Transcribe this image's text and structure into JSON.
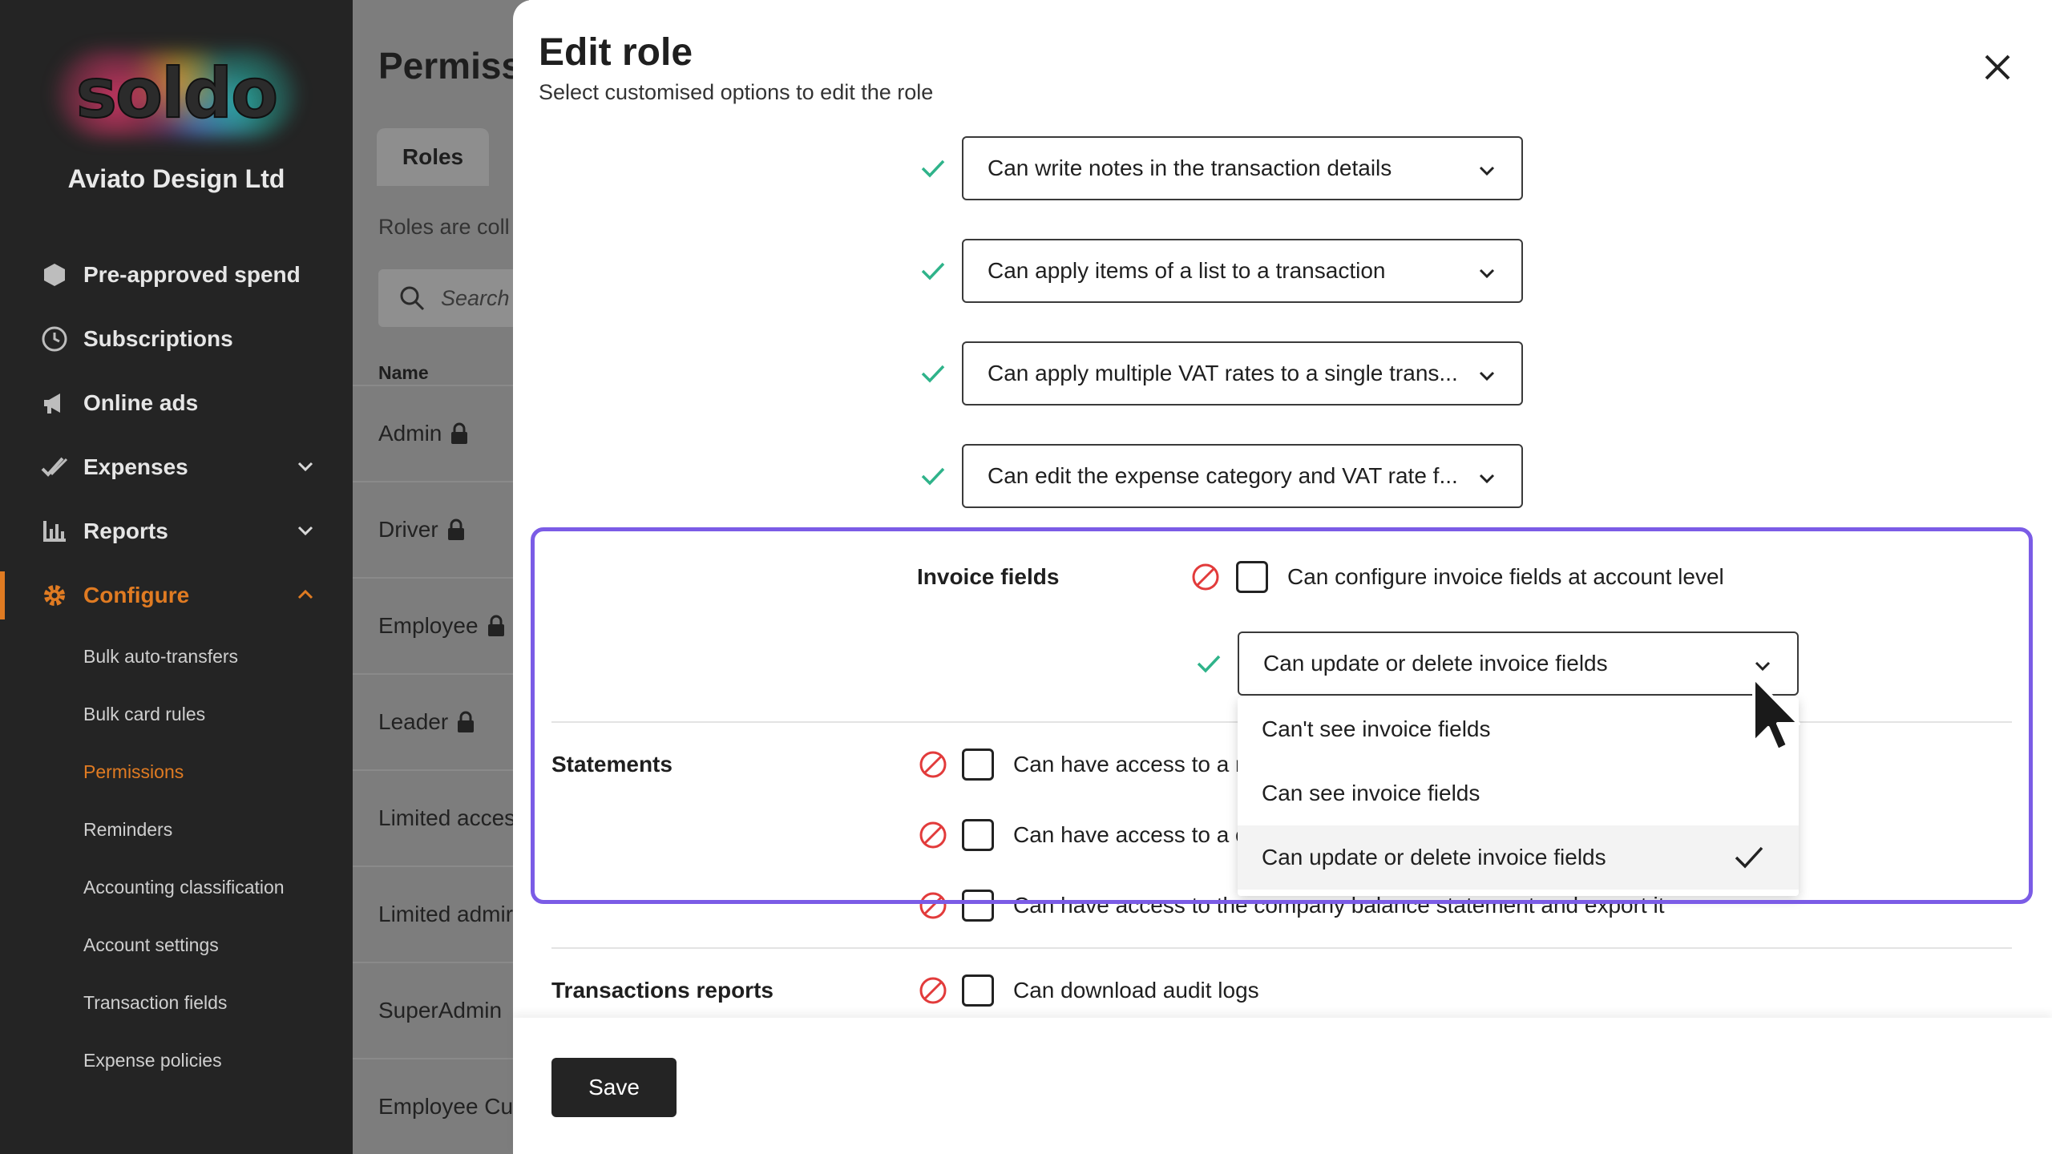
{
  "sidebar": {
    "logo_text": "soldo",
    "company": "Aviato Design Ltd",
    "nav": [
      {
        "label": "Pre-approved spend",
        "icon": "hexagon-icon"
      },
      {
        "label": "Subscriptions",
        "icon": "clock-icon"
      },
      {
        "label": "Online ads",
        "icon": "megaphone-icon"
      },
      {
        "label": "Expenses",
        "icon": "check-double-icon"
      },
      {
        "label": "Reports",
        "icon": "bar-chart-icon"
      },
      {
        "label": "Configure",
        "icon": "gear-icon"
      }
    ],
    "sub": [
      {
        "label": "Bulk auto-transfers"
      },
      {
        "label": "Bulk card rules"
      },
      {
        "label": "Permissions"
      },
      {
        "label": "Reminders"
      },
      {
        "label": "Accounting classification"
      },
      {
        "label": "Account settings"
      },
      {
        "label": "Transaction fields"
      },
      {
        "label": "Expense policies"
      }
    ],
    "accent": "#e07b22"
  },
  "middle": {
    "title": "Permiss",
    "tab": "Roles",
    "desc": "Roles are coll",
    "search_placeholder": "Search",
    "column": "Name",
    "rows": [
      {
        "label": "Admin"
      },
      {
        "label": "Driver"
      },
      {
        "label": "Employee"
      },
      {
        "label": "Leader"
      },
      {
        "label": "Limited acces"
      },
      {
        "label": "Limited admir"
      },
      {
        "label": "SuperAdmin"
      },
      {
        "label": "Employee Cus"
      }
    ]
  },
  "modal": {
    "title": "Edit role",
    "subtitle": "Select customised options to edit the role",
    "selects": [
      {
        "value": "Can write notes in the transaction details"
      },
      {
        "value": "Can apply items of a list to a transaction"
      },
      {
        "value": "Can apply multiple VAT rates to a single trans..."
      },
      {
        "value": "Can edit the expense category and VAT rate f..."
      }
    ],
    "invoice": {
      "label": "Invoice fields",
      "checkbox_label": "Can configure invoice fields at account level",
      "select_value": "Can update or delete invoice fields",
      "options": [
        {
          "label": "Can't see invoice fields"
        },
        {
          "label": "Can see invoice fields"
        },
        {
          "label": "Can update or delete invoice fields"
        }
      ]
    },
    "statements": {
      "label": "Statements",
      "items": [
        {
          "label": "Can have access to a m"
        },
        {
          "label": "Can have access to a c"
        },
        {
          "label": "Can have access to the company balance statement and export it"
        }
      ]
    },
    "transactions_reports": {
      "label": "Transactions reports",
      "items": [
        {
          "label": "Can download audit logs"
        }
      ]
    },
    "save_label": "Save",
    "colors": {
      "ok": "#2fb38a",
      "deny": "#e23b3b",
      "highlight": "#7b5ce6"
    }
  }
}
